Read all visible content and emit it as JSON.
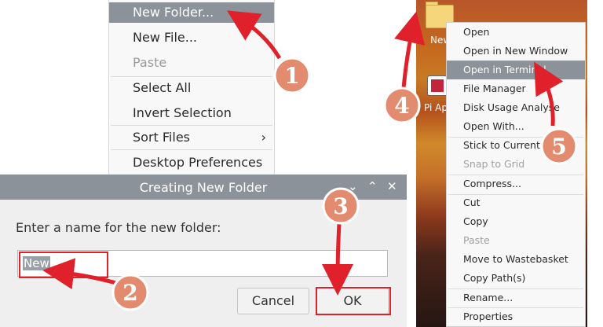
{
  "left_menu": {
    "items": [
      {
        "label": "New Folder...",
        "state": "highlighted"
      },
      {
        "label": "New File...",
        "state": "normal"
      },
      {
        "label": "Paste",
        "state": "disabled"
      },
      {
        "label": "Select All",
        "state": "normal"
      },
      {
        "label": "Invert Selection",
        "state": "normal"
      },
      {
        "label": "Sort Files",
        "state": "normal",
        "submenu": "›"
      },
      {
        "label": "Desktop Preferences",
        "state": "normal"
      }
    ]
  },
  "dialog": {
    "title": "Creating New Folder",
    "title_buttons": [
      "⌄",
      "⌃",
      "✕"
    ],
    "prompt": "Enter a name for the new folder:",
    "input_value": "New",
    "cancel_label": "Cancel",
    "ok_label": "OK"
  },
  "desktop": {
    "folder_label": "New",
    "app_label": "Pi Ap"
  },
  "right_menu": {
    "items": [
      {
        "label": "Open",
        "state": "normal"
      },
      {
        "label": "Open in New Window",
        "state": "normal"
      },
      {
        "label": "Open in Terminal",
        "state": "highlighted"
      },
      {
        "label": "File Manager",
        "state": "normal"
      },
      {
        "label": "Disk Usage Analyse",
        "state": "normal"
      },
      {
        "label": "Open With...",
        "state": "normal"
      },
      {
        "label": "Stick to Current Po",
        "state": "normal"
      },
      {
        "label": "Snap to Grid",
        "state": "disabled"
      },
      {
        "label": "Compress...",
        "state": "normal"
      },
      {
        "label": "Cut",
        "state": "normal"
      },
      {
        "label": "Copy",
        "state": "normal"
      },
      {
        "label": "Paste",
        "state": "disabled"
      },
      {
        "label": "Move to Wastebasket",
        "state": "normal"
      },
      {
        "label": "Copy Path(s)",
        "state": "normal"
      },
      {
        "label": "Rename...",
        "state": "normal"
      },
      {
        "label": "Properties",
        "state": "normal"
      }
    ]
  },
  "annotations": {
    "steps": [
      "1",
      "2",
      "3",
      "4",
      "5"
    ],
    "circle_fill": "#e38b6f",
    "arrow_color": "#e0202a"
  }
}
